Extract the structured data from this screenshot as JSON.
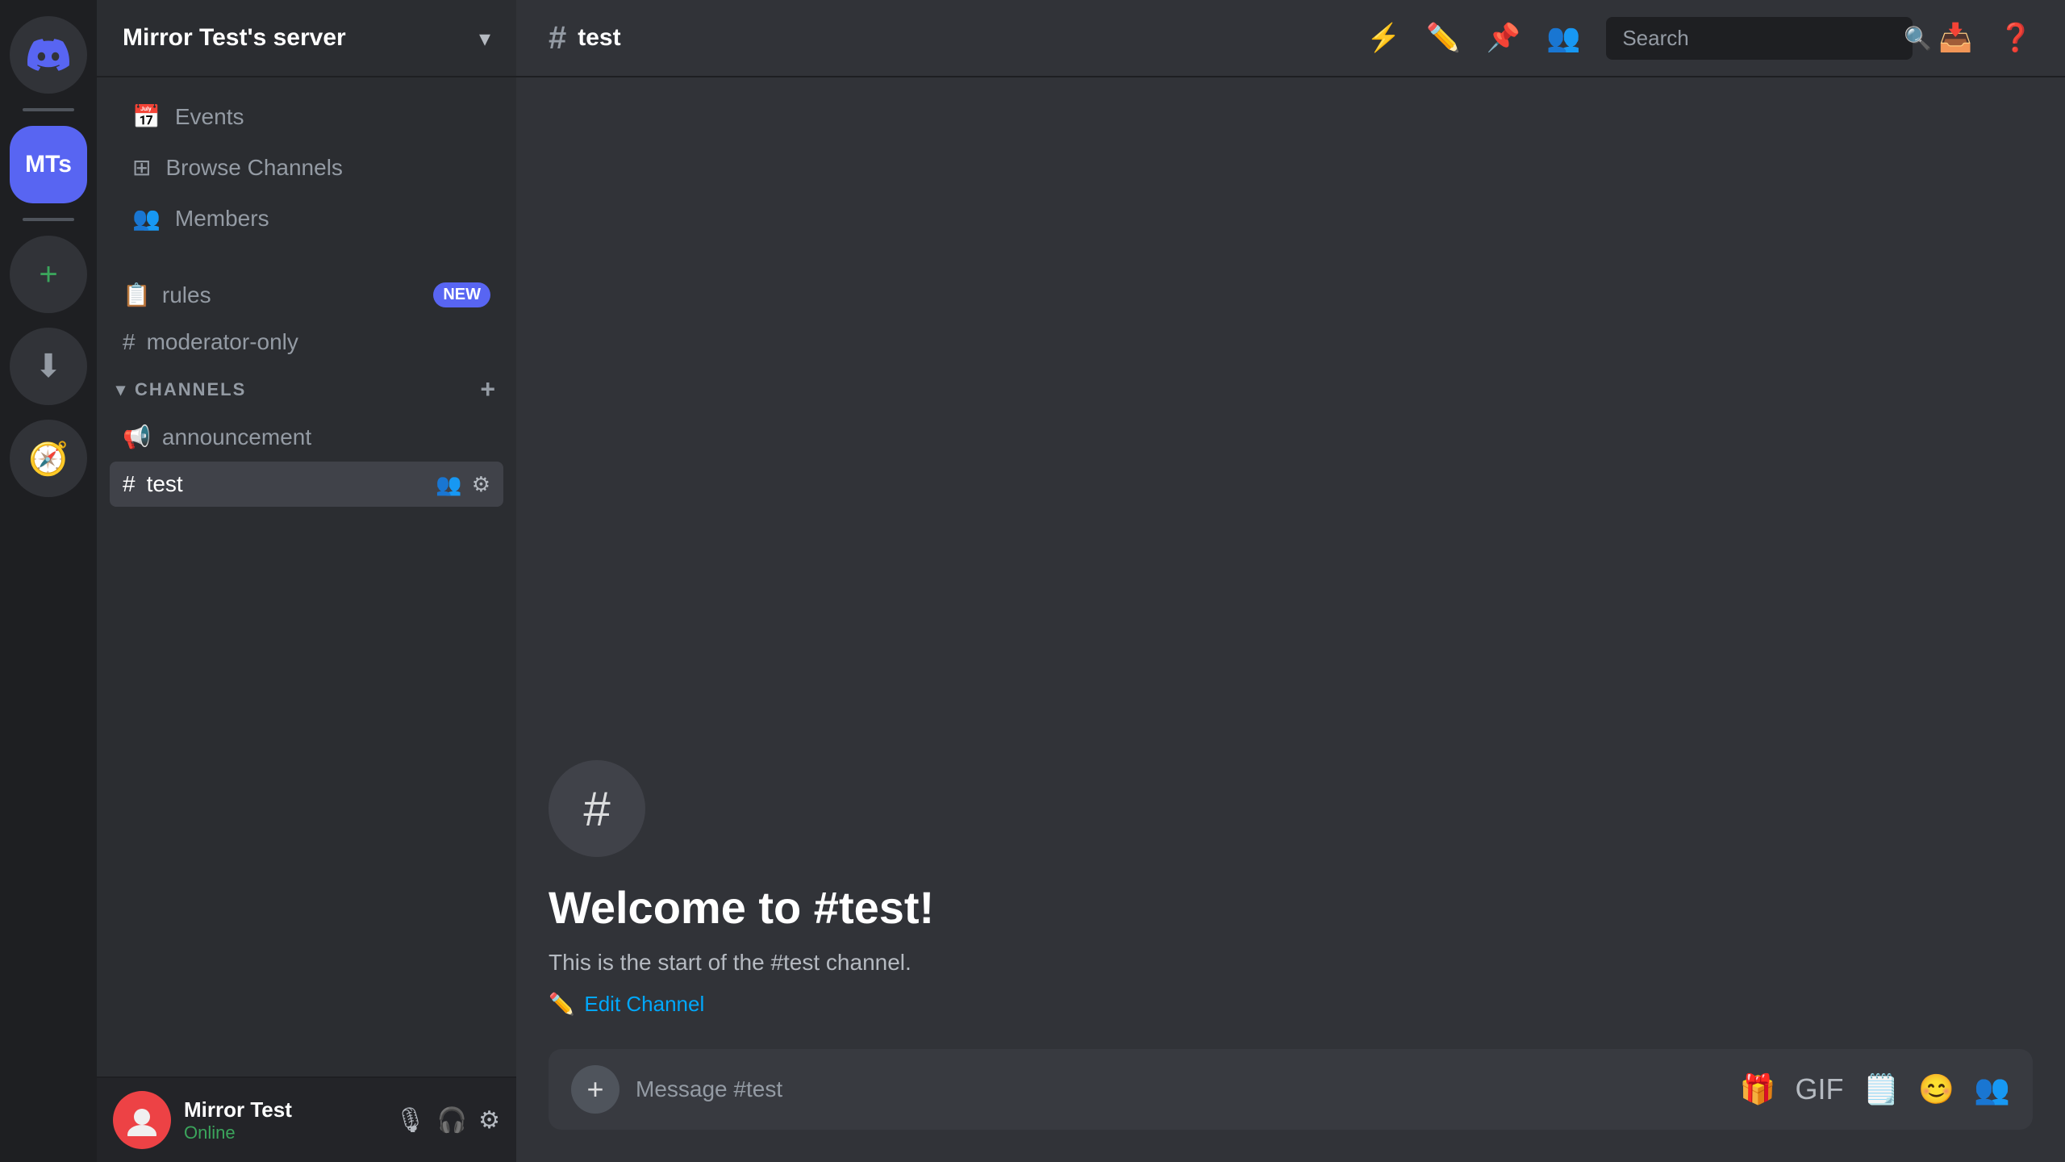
{
  "serverRail": {
    "discordLogoLabel": "Discord",
    "serverInitials": "MTs",
    "addServerLabel": "+",
    "downloadLabel": "⬇"
  },
  "sidebar": {
    "serverName": "Mirror Test's server",
    "chevron": "▾",
    "navItems": [
      {
        "id": "events",
        "icon": "📅",
        "label": "Events"
      },
      {
        "id": "browse-channels",
        "icon": "⊞",
        "label": "Browse Channels"
      },
      {
        "id": "members",
        "icon": "👥",
        "label": "Members"
      }
    ],
    "channels": {
      "ungrouped": [
        {
          "id": "rules",
          "type": "rules",
          "icon": "📋",
          "label": "rules",
          "badge": "NEW"
        },
        {
          "id": "moderator-only",
          "type": "hash",
          "icon": "#",
          "label": "moderator-only"
        }
      ],
      "category": "CHANNELS",
      "grouped": [
        {
          "id": "announcement",
          "type": "megaphone",
          "icon": "📢",
          "label": "announcement"
        },
        {
          "id": "test",
          "type": "hash",
          "icon": "#",
          "label": "test",
          "active": true
        }
      ]
    }
  },
  "sidebarFooter": {
    "avatarInitials": "",
    "username": "Mirror Test",
    "status": "Online"
  },
  "mainHeader": {
    "channelHash": "#",
    "channelName": "test"
  },
  "headerActions": {
    "searchPlaceholder": "Search",
    "icons": [
      "bolt",
      "pencil",
      "pin",
      "members",
      "search",
      "inbox",
      "help"
    ]
  },
  "welcomeSection": {
    "iconChar": "#",
    "title": "Welcome to #test!",
    "description": "This is the start of the #test channel.",
    "editChannelLabel": "Edit Channel"
  },
  "messageInput": {
    "placeholder": "Message #test"
  }
}
